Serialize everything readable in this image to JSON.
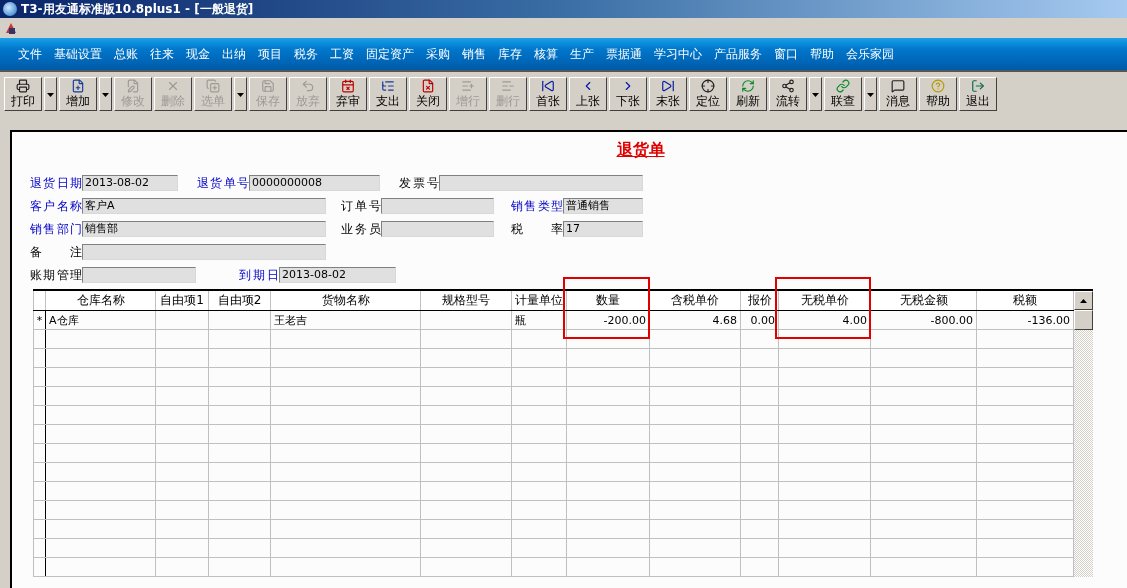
{
  "window": {
    "title": "T3-用友通标准版10.8plus1 - [一般退货]"
  },
  "menu": [
    "文件",
    "基础设置",
    "总账",
    "往来",
    "现金",
    "出纳",
    "项目",
    "税务",
    "工资",
    "固定资产",
    "采购",
    "销售",
    "库存",
    "核算",
    "生产",
    "票据通",
    "学习中心",
    "产品服务",
    "窗口",
    "帮助",
    "会乐家园"
  ],
  "toolbar": [
    {
      "kind": "button",
      "label": "打印",
      "disabled": false
    },
    {
      "kind": "dropdown",
      "disabled": false
    },
    {
      "kind": "button",
      "label": "增加",
      "disabled": false
    },
    {
      "kind": "dropdown",
      "disabled": false
    },
    {
      "kind": "button",
      "label": "修改",
      "disabled": true
    },
    {
      "kind": "button",
      "label": "删除",
      "disabled": true
    },
    {
      "kind": "button",
      "label": "选单",
      "disabled": true
    },
    {
      "kind": "dropdown",
      "disabled": false
    },
    {
      "kind": "button",
      "label": "保存",
      "disabled": true
    },
    {
      "kind": "button",
      "label": "放弃",
      "disabled": true
    },
    {
      "kind": "button",
      "label": "弃审",
      "disabled": false
    },
    {
      "kind": "button",
      "label": "支出",
      "disabled": false
    },
    {
      "kind": "button",
      "label": "关闭",
      "disabled": false
    },
    {
      "kind": "button",
      "label": "增行",
      "disabled": true
    },
    {
      "kind": "button",
      "label": "删行",
      "disabled": true
    },
    {
      "kind": "button",
      "label": "首张",
      "disabled": false
    },
    {
      "kind": "button",
      "label": "上张",
      "disabled": false
    },
    {
      "kind": "button",
      "label": "下张",
      "disabled": false
    },
    {
      "kind": "button",
      "label": "末张",
      "disabled": false
    },
    {
      "kind": "button",
      "label": "定位",
      "disabled": false
    },
    {
      "kind": "button",
      "label": "刷新",
      "disabled": false
    },
    {
      "kind": "button",
      "label": "流转",
      "disabled": false
    },
    {
      "kind": "dropdown",
      "disabled": false
    },
    {
      "kind": "button",
      "label": "联查",
      "disabled": false
    },
    {
      "kind": "dropdown",
      "disabled": false
    },
    {
      "kind": "button",
      "label": "消息",
      "disabled": false
    },
    {
      "kind": "button",
      "label": "帮助",
      "disabled": false
    },
    {
      "kind": "button",
      "label": "退出",
      "disabled": false
    }
  ],
  "document": {
    "title": "退货单",
    "form": [
      [
        {
          "label": "退货日期",
          "required": true,
          "value": "2013-08-02"
        },
        {
          "label": "退货单号",
          "required": true,
          "value": "0000000008"
        },
        {
          "label": "发票号",
          "required": false
        }
      ],
      [
        {
          "label": "客户名称",
          "required": true,
          "value": "客户A"
        },
        {
          "label": "订单号",
          "required": false
        },
        {
          "label": "销售类型",
          "required": true,
          "value": "普通销售"
        }
      ],
      [
        {
          "label": "销售部门",
          "required": true,
          "value": "销售部"
        },
        {
          "label": "业务员",
          "required": false
        },
        {
          "label": "税 率",
          "required": false,
          "value": "17"
        }
      ],
      [
        {
          "label": "备 注",
          "required": false
        }
      ],
      [
        {
          "label": "账期管理",
          "required": false
        },
        {
          "label": "到期日",
          "required": true,
          "value": "2013-08-02"
        }
      ]
    ],
    "table": {
      "columns": [
        {
          "label": "仓库名称",
          "highlighted": false
        },
        {
          "label": "自由项1",
          "highlighted": false
        },
        {
          "label": "自由项2",
          "highlighted": false
        },
        {
          "label": "货物名称",
          "highlighted": false
        },
        {
          "label": "规格型号",
          "highlighted": false
        },
        {
          "label": "计量单位",
          "highlighted": false
        },
        {
          "label": "数量",
          "highlighted": true
        },
        {
          "label": "含税单价",
          "highlighted": false
        },
        {
          "label": "报价",
          "highlighted": false
        },
        {
          "label": "无税单价",
          "highlighted": true
        },
        {
          "label": "无税金额",
          "highlighted": false
        },
        {
          "label": "税额",
          "highlighted": false
        }
      ],
      "rows": [
        {
          "marker": "*",
          "cells": [
            "A仓库",
            "",
            "",
            "王老吉",
            "",
            "瓶",
            "-200.00",
            "4.68",
            "0.00",
            "4.00",
            "-800.00",
            "-136.00"
          ]
        }
      ]
    }
  }
}
